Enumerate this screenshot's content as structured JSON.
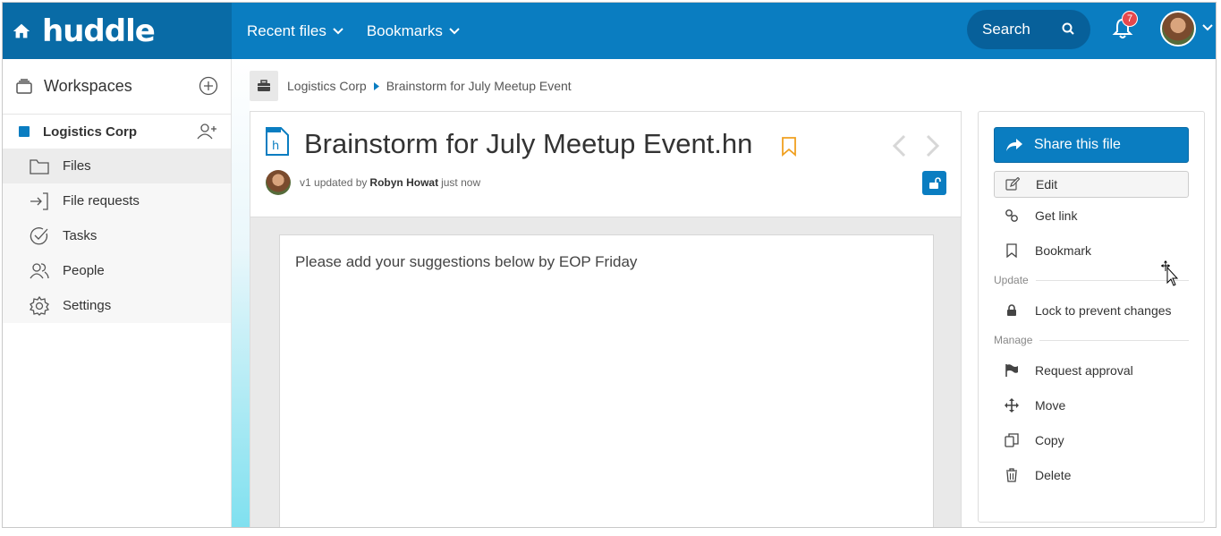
{
  "brand": {
    "logo": "huddle"
  },
  "nav": [
    {
      "label": "Recent files"
    },
    {
      "label": "Bookmarks"
    }
  ],
  "search": {
    "label": "Search"
  },
  "notifications": {
    "count": "7"
  },
  "sidebar": {
    "workspaces_label": "Workspaces",
    "workspace_name": "Logistics Corp",
    "items": [
      {
        "label": "Files",
        "icon": "folder-icon",
        "active": true
      },
      {
        "label": "File requests",
        "icon": "file-request-icon"
      },
      {
        "label": "Tasks",
        "icon": "tasks-icon"
      },
      {
        "label": "People",
        "icon": "people-icon"
      },
      {
        "label": "Settings",
        "icon": "gear-icon"
      }
    ]
  },
  "breadcrumb": {
    "workspace": "Logistics Corp",
    "current": "Brainstorm for July Meetup Event"
  },
  "document": {
    "title": "Brainstorm for July Meetup Event.hn",
    "version": "v1",
    "updated_by_prefix": "updated by",
    "author": "Robyn Howat",
    "time": "just now",
    "content": "Please add your suggestions below by EOP Friday"
  },
  "actions": {
    "share": "Share this file",
    "edit": "Edit",
    "get_link": "Get link",
    "bookmark": "Bookmark",
    "update_section": "Update",
    "lock": "Lock to prevent changes",
    "manage_section": "Manage",
    "request_approval": "Request approval",
    "move": "Move",
    "copy": "Copy",
    "delete": "Delete"
  },
  "colors": {
    "primary": "#0a7dc1",
    "bookmark": "#f0a020",
    "badge": "#e5484d"
  }
}
